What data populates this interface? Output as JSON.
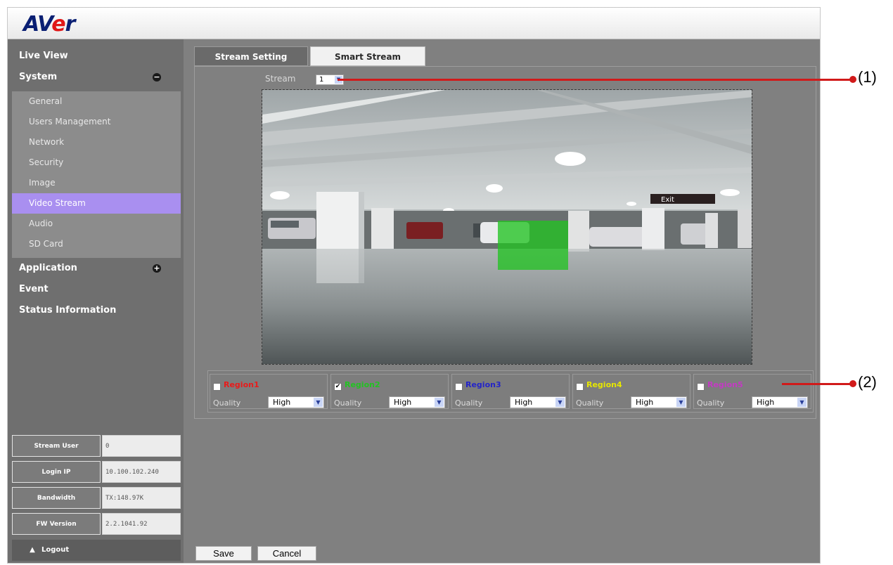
{
  "brand": {
    "logo_prefix": "AV",
    "logo_e": "e",
    "logo_suffix": "r"
  },
  "sidebar": {
    "main_items": [
      "Live View",
      "System",
      "Application",
      "Event",
      "Status Information"
    ],
    "system_toggle": "−",
    "application_toggle": "+",
    "system_subitems": [
      "General",
      "Users Management",
      "Network",
      "Security",
      "Image",
      "Video Stream",
      "Audio",
      "SD Card"
    ],
    "active_subitem": "Video Stream"
  },
  "info": {
    "rows": [
      {
        "label": "Stream User",
        "value": "0"
      },
      {
        "label": "Login IP",
        "value": "10.100.102.240"
      },
      {
        "label": "Bandwidth",
        "value": "TX:148.97K"
      },
      {
        "label": "FW Version",
        "value": "2.2.1041.92"
      }
    ],
    "logout": "Logout"
  },
  "tabs": [
    "Stream Setting",
    "Smart Stream"
  ],
  "active_tab": "Smart Stream",
  "stream": {
    "label": "Stream",
    "value": "1"
  },
  "video": {
    "exit_sign": "Exit"
  },
  "regions": [
    {
      "name": "Region1",
      "checked": false,
      "color": "#e81b1b",
      "quality": "High"
    },
    {
      "name": "Region2",
      "checked": true,
      "color": "#22c322",
      "quality": "High"
    },
    {
      "name": "Region3",
      "checked": false,
      "color": "#2424c8",
      "quality": "High"
    },
    {
      "name": "Region4",
      "checked": false,
      "color": "#e6e600",
      "quality": "High"
    },
    {
      "name": "Region5",
      "checked": false,
      "color": "#c43ac4",
      "quality": "High"
    }
  ],
  "quality_label": "Quality",
  "buttons": {
    "save": "Save",
    "cancel": "Cancel"
  },
  "annotations": [
    "(1)",
    "(2)"
  ],
  "colors": {
    "accent_active": "#a98ff0",
    "annotation": "#d11a1a",
    "roi_fill": "#22c322"
  }
}
